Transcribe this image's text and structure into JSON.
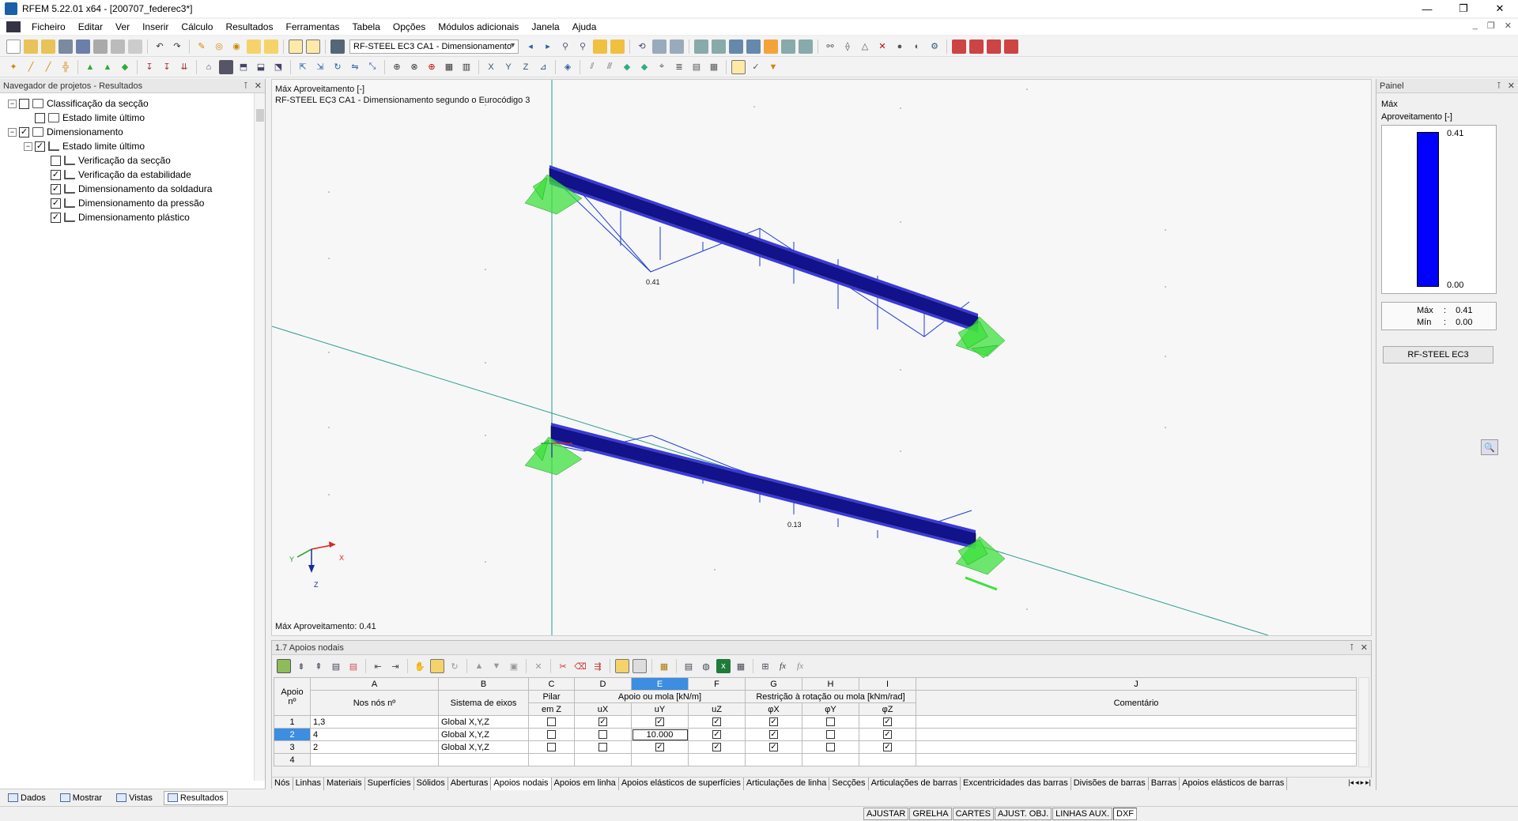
{
  "window": {
    "title": "RFEM 5.22.01 x64 - [200707_federec3*]",
    "controls": [
      "—",
      "❐",
      "✕"
    ]
  },
  "menu": {
    "items": [
      "Ficheiro",
      "Editar",
      "Ver",
      "Inserir",
      "Cálculo",
      "Resultados",
      "Ferramentas",
      "Tabela",
      "Opções",
      "Módulos adicionais",
      "Janela",
      "Ajuda"
    ],
    "doc_controls": [
      "_",
      "❐",
      "✕"
    ]
  },
  "toolbar": {
    "case_combo": "RF-STEEL EC3 CA1 - Dimensionamento"
  },
  "navigator": {
    "title": "Navegador de projetos - Resultados",
    "tree": [
      {
        "label": "Classificação da secção",
        "level": 0,
        "checked": false,
        "expanded": true
      },
      {
        "label": "Estado limite último",
        "level": 1,
        "checked": false
      },
      {
        "label": "Dimensionamento",
        "level": 0,
        "checked": true,
        "expanded": true
      },
      {
        "label": "Estado limite último",
        "level": 1,
        "checked": true,
        "expanded": true
      },
      {
        "label": "Verificação da secção",
        "level": 2,
        "checked": false
      },
      {
        "label": "Verificação da estabilidade",
        "level": 2,
        "checked": true
      },
      {
        "label": "Dimensionamento da soldadura",
        "level": 2,
        "checked": true
      },
      {
        "label": "Dimensionamento da pressão",
        "level": 2,
        "checked": true
      },
      {
        "label": "Dimensionamento plástico",
        "level": 2,
        "checked": true
      }
    ],
    "bottom_tabs": [
      "Dados",
      "Mostrar",
      "Vistas",
      "Resultados"
    ]
  },
  "viewport": {
    "header_line1": "Máx Aproveitamento [-]",
    "header_line2": "RF-STEEL EC3 CA1 - Dimensionamento segundo o Eurocódigo 3",
    "footer": "Máx Aproveitamento: 0.41",
    "label_top": "0.41",
    "label_bottom": "0.13",
    "axis_x": "X",
    "axis_y": "Y",
    "axis_z": "Z"
  },
  "panel": {
    "title": "Painel",
    "subtitle1": "Máx",
    "subtitle2": "Aproveitamento [-]",
    "legend_max": "0.41",
    "legend_min": "0.00",
    "max_label": "Máx",
    "max_value": "0.41",
    "min_label": "Mín",
    "min_value": "0.00",
    "button": "RF-STEEL EC3",
    "bar_color": "#0000ff"
  },
  "table": {
    "title": "1.7 Apoios nodais",
    "col_letters": [
      "A",
      "B",
      "C",
      "D",
      "E",
      "F",
      "G",
      "H",
      "I",
      "J"
    ],
    "header_row1": {
      "apoio": "Apoio",
      "pilar": "Pilar",
      "mola": "Apoio ou mola [kN/m]",
      "rot": "Restrição à rotação ou mola [kNm/rad]"
    },
    "header_row2": {
      "apoio_n": "nº",
      "nos": "Nos nós nº",
      "sistema": "Sistema de eixos",
      "pilar_z": "em Z",
      "ux": "uX",
      "uy": "uY",
      "uz": "uZ",
      "px": "φX",
      "py": "φY",
      "pz": "φZ",
      "comentario": "Comentário"
    },
    "rows": [
      {
        "n": "1",
        "nos": "1,3",
        "sistema": "Global X,Y,Z",
        "pilar": false,
        "ux": true,
        "uy": "check",
        "uz": true,
        "px": true,
        "py": false,
        "pz": true
      },
      {
        "n": "2",
        "nos": "4",
        "sistema": "Global X,Y,Z",
        "pilar": false,
        "ux": false,
        "uy": "10.000",
        "uz": true,
        "px": true,
        "py": false,
        "pz": true
      },
      {
        "n": "3",
        "nos": "2",
        "sistema": "Global X,Y,Z",
        "pilar": false,
        "ux": false,
        "uy": "check",
        "uz": true,
        "px": true,
        "py": false,
        "pz": true
      },
      {
        "n": "4",
        "nos": "",
        "sistema": "",
        "pilar": null,
        "ux": null,
        "uy": null,
        "uz": null,
        "px": null,
        "py": null,
        "pz": null
      }
    ],
    "sheet_tabs": [
      "Nós",
      "Linhas",
      "Materiais",
      "Superfícies",
      "Sólidos",
      "Aberturas",
      "Apoios nodais",
      "Apoios em linha",
      "Apoios elásticos de superfícies",
      "Articulações de linha",
      "Secções",
      "Articulações de barras",
      "Excentricidades das barras",
      "Divisões de barras",
      "Barras",
      "Apoios elásticos de barras"
    ],
    "active_tab": "Apoios nodais"
  },
  "statusbar": {
    "items": [
      "AJUSTAR",
      "GRELHA",
      "CARTES",
      "AJUST. OBJ.",
      "LINHAS AUX.",
      "DXF"
    ]
  }
}
